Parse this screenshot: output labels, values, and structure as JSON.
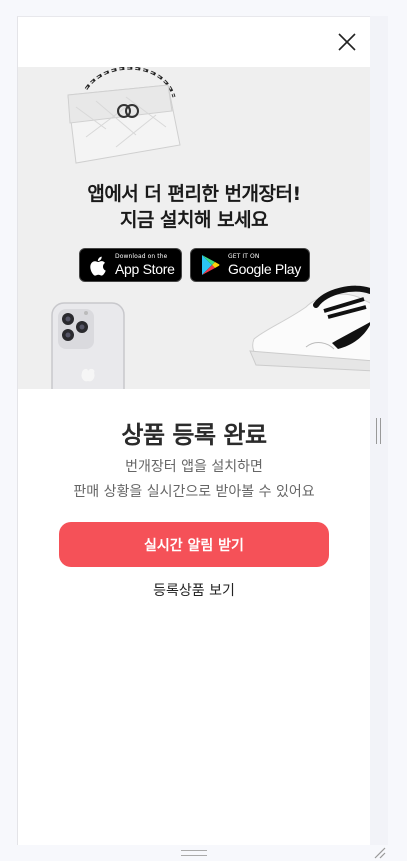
{
  "promo": {
    "title_line1": "앱에서 더 편리한 번개장터!",
    "title_line2": "지금 설치해 보세요",
    "app_store": {
      "small": "Download on the",
      "big": "App Store"
    },
    "google_play": {
      "small": "GET IT ON",
      "big": "Google Play"
    }
  },
  "status": {
    "title": "상품 등록 완료",
    "desc_line1": "번개장터 앱을 설치하면",
    "desc_line2": "판매 상황을 실시간으로 받아볼 수 있어요"
  },
  "actions": {
    "primary_label": "실시간 알림 받기",
    "secondary_label": "등록상품 보기"
  },
  "colors": {
    "accent": "#f55158",
    "promo_bg": "#efefef"
  },
  "icons": [
    "close-icon",
    "apple-icon",
    "google-play-icon"
  ]
}
